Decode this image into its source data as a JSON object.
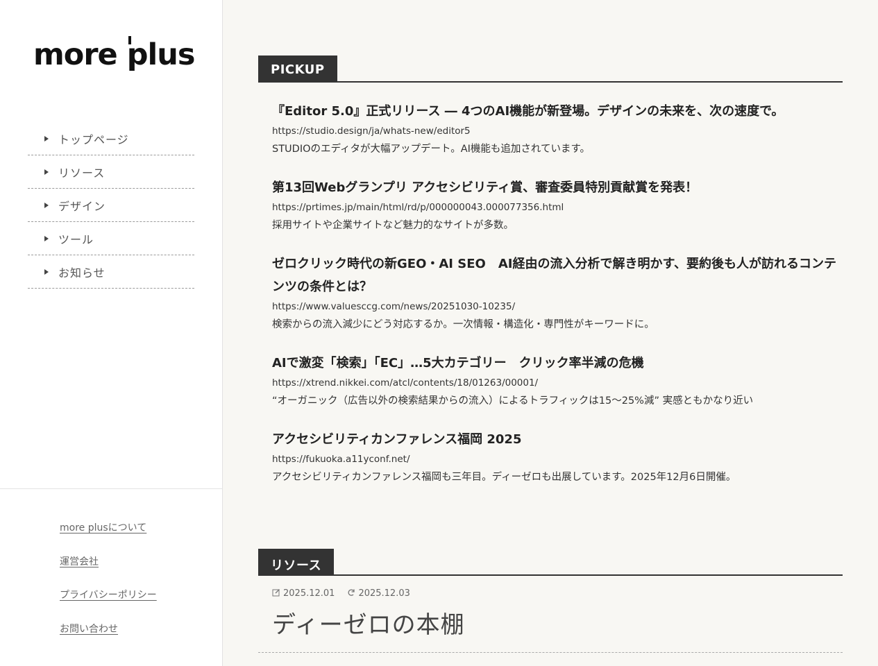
{
  "brand": {
    "logo_text_1": "more ",
    "logo_text_p": "p",
    "logo_text_2": "lus"
  },
  "nav": {
    "items": [
      {
        "label": "トップページ"
      },
      {
        "label": "リソース"
      },
      {
        "label": "デザイン"
      },
      {
        "label": "ツール"
      },
      {
        "label": "お知らせ"
      }
    ]
  },
  "footer": {
    "links": [
      {
        "label": "more plusについて"
      },
      {
        "label": "運営会社"
      },
      {
        "label": "プライバシーポリシー"
      },
      {
        "label": "お問い合わせ"
      }
    ]
  },
  "pickup": {
    "heading": "PICKUP",
    "items": [
      {
        "title": "『Editor 5.0』正式リリース ― 4つのAI機能が新登場。デザインの未来を、次の速度で。",
        "url": "https://studio.design/ja/whats-new/editor5",
        "desc": "STUDIOのエディタが大幅アップデート。AI機能も追加されています。"
      },
      {
        "title": "第13回Webグランプリ アクセシビリティ賞、審査委員特別貢献賞を発表！",
        "url": "https://prtimes.jp/main/html/rd/p/000000043.000077356.html",
        "desc": "採用サイトや企業サイトなど魅力的なサイトが多数。"
      },
      {
        "title": "ゼロクリック時代の新GEO・AI SEO　AI経由の流入分析で解き明かす、要約後も人が訪れるコンテンツの条件とは？",
        "url": "https://www.valuesccg.com/news/20251030-10235/",
        "desc": "検索からの流入減少にどう対応するか。一次情報・構造化・専門性がキーワードに。"
      },
      {
        "title": "AIで激変「検索」「EC」…5大カテゴリー　クリック率半減の危機",
        "url": "https://xtrend.nikkei.com/atcl/contents/18/01263/00001/",
        "desc": "“オーガニック（広告以外の検索結果からの流入）によるトラフィックは15～25%減” 実感ともかなり近い"
      },
      {
        "title": "アクセシビリティカンファレンス福岡 2025",
        "url": "https://fukuoka.a11yconf.net/",
        "desc": "アクセシビリティカンファレンス福岡も三年目。ディーゼロも出展しています。2025年12月6日開催。"
      }
    ]
  },
  "resources": {
    "heading": "リソース",
    "article": {
      "published": "2025.12.01",
      "updated": "2025.12.03",
      "title": "ディーゼロの本棚",
      "published_icon": "edit-icon",
      "updated_icon": "refresh-icon"
    }
  },
  "colors": {
    "sidebar_bg": "#ffffff",
    "main_bg": "#f8f7f3",
    "heading_bg": "#333333"
  }
}
